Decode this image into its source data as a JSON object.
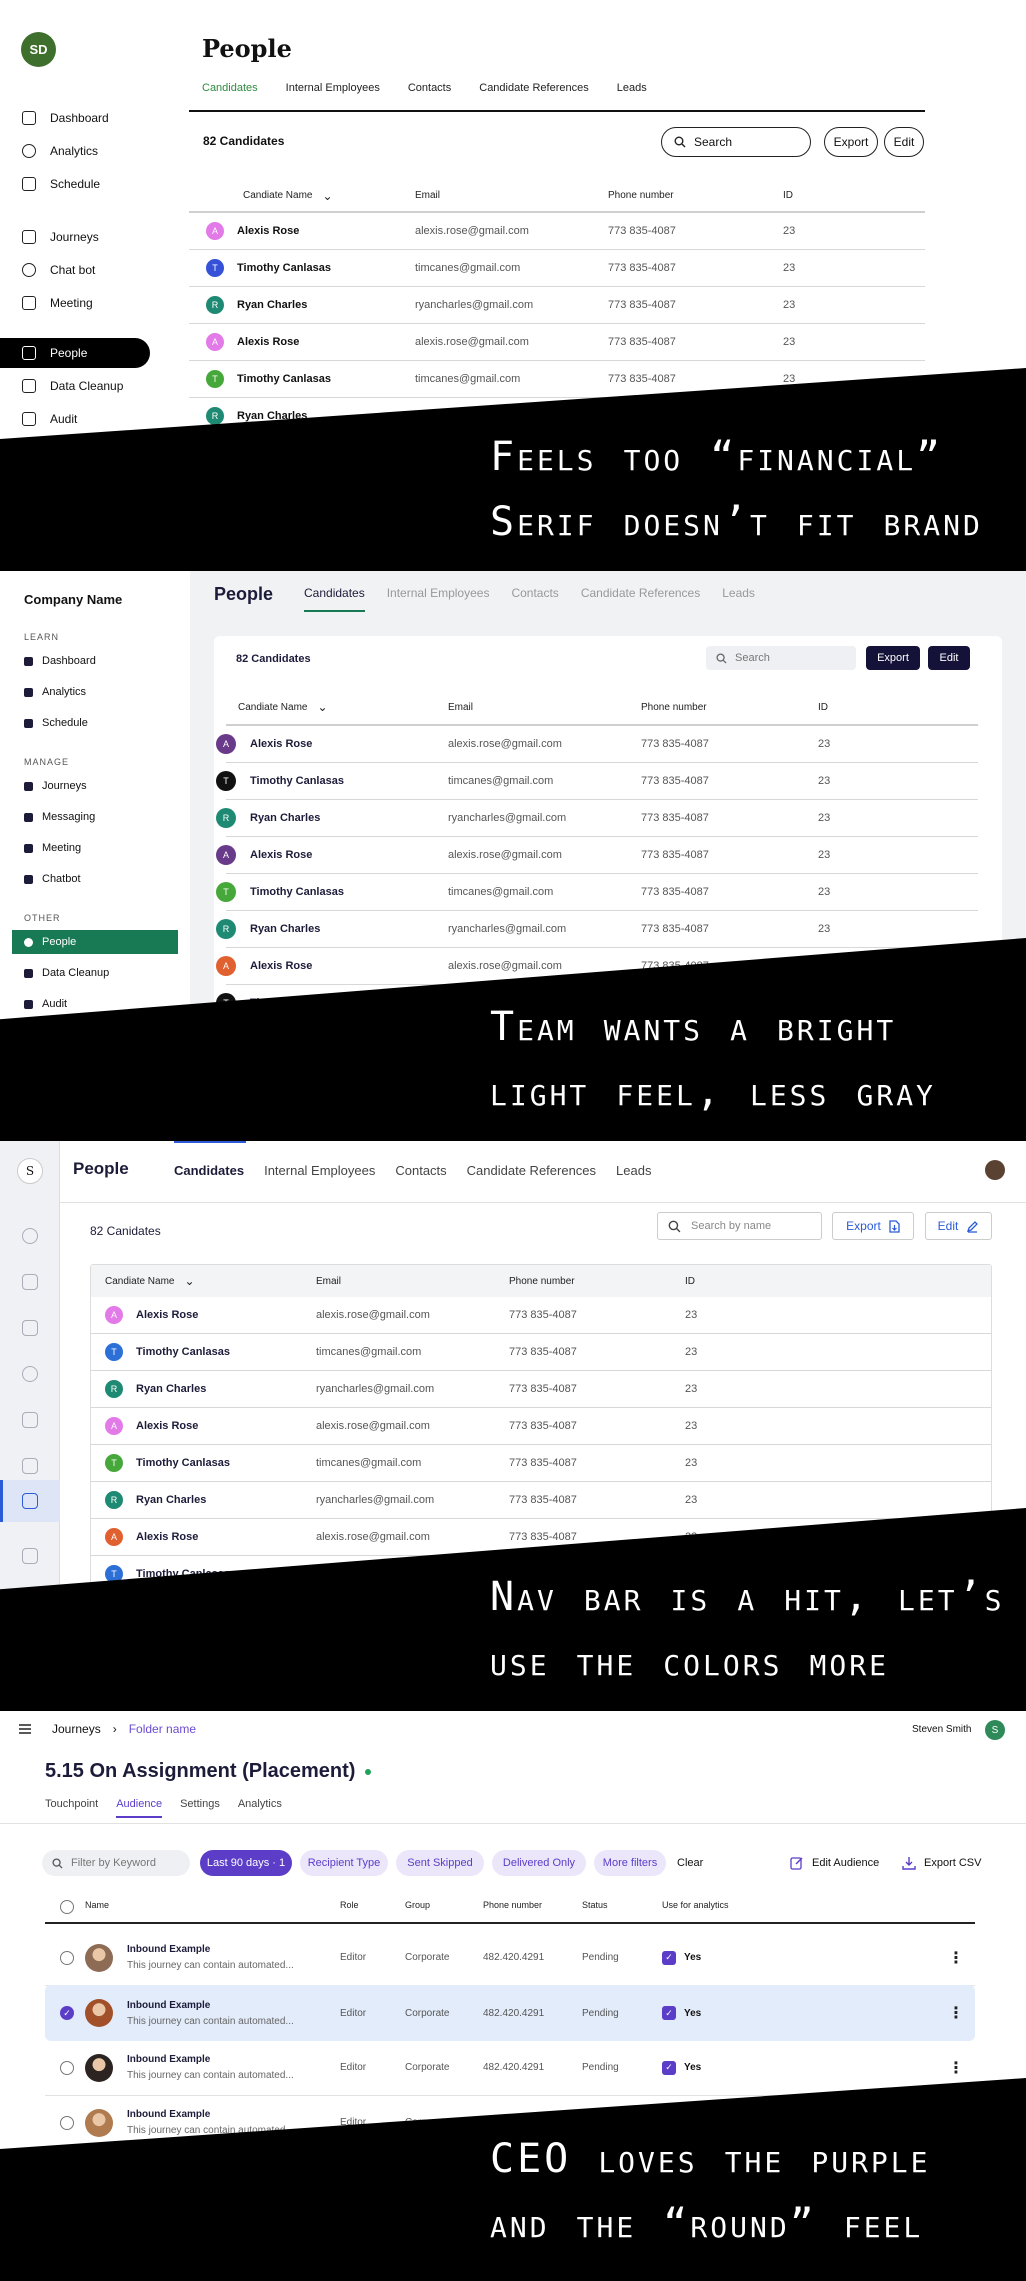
{
  "colors": {
    "v1_accent": "#2e8a3e",
    "v2_accent": "#177a55",
    "v2_button": "#141238",
    "v3_accent": "#2b5bd7",
    "v4_accent": "#5b3dc8"
  },
  "v1": {
    "avatar": "SD",
    "nav": [
      {
        "label": "Dashboard",
        "icon": "home-icon"
      },
      {
        "label": "Analytics",
        "icon": "analytics-icon"
      },
      {
        "label": "Schedule",
        "icon": "calendar-icon"
      },
      {
        "label": "Journeys",
        "icon": "link-icon"
      },
      {
        "label": "Chat bot",
        "icon": "chat-icon"
      },
      {
        "label": "Meeting",
        "icon": "meeting-icon"
      },
      {
        "label": "People",
        "icon": "people-icon"
      },
      {
        "label": "Data Cleanup",
        "icon": "table-icon"
      },
      {
        "label": "Audit",
        "icon": "clipboard-icon"
      }
    ],
    "title": "People",
    "tabs": [
      "Candidates",
      "Internal Employees",
      "Contacts",
      "Candidate References",
      "Leads"
    ],
    "count": "82 Candidates",
    "search": "Search",
    "export": "Export",
    "edit": "Edit",
    "columns": [
      "Candiate Name",
      "Email",
      "Phone number",
      "ID"
    ],
    "rows": [
      {
        "i": "A",
        "name": "Alexis Rose",
        "email": "alexis.rose@gmail.com",
        "phone": "773 835-4087",
        "id": "23",
        "color": "#e27ae8"
      },
      {
        "i": "T",
        "name": "Timothy Canlasas",
        "email": "timcanes@gmail.com",
        "phone": "773 835-4087",
        "id": "23",
        "color": "#3451d8"
      },
      {
        "i": "R",
        "name": "Ryan Charles",
        "email": "ryancharles@gmail.com",
        "phone": "773 835-4087",
        "id": "23",
        "color": "#1f8a73"
      },
      {
        "i": "A",
        "name": "Alexis Rose",
        "email": "alexis.rose@gmail.com",
        "phone": "773 835-4087",
        "id": "23",
        "color": "#e27ae8"
      },
      {
        "i": "T",
        "name": "Timothy Canlasas",
        "email": "timcanes@gmail.com",
        "phone": "773 835-4087",
        "id": "23",
        "color": "#46a83a"
      },
      {
        "i": "R",
        "name": "Ryan Charles",
        "email": "",
        "phone": "",
        "id": "",
        "color": "#1f8a73"
      }
    ],
    "note": [
      "Feels too “financial”",
      "Serif doesn’t fit brand"
    ]
  },
  "v2": {
    "company": "Company Name",
    "sections": [
      {
        "label": "LEARN",
        "items": [
          "Dashboard",
          "Analytics",
          "Schedule"
        ]
      },
      {
        "label": "MANAGE",
        "items": [
          "Journeys",
          "Messaging",
          "Meeting",
          "Chatbot"
        ]
      },
      {
        "label": "OTHER",
        "items": [
          "People",
          "Data Cleanup",
          "Audit"
        ]
      }
    ],
    "title": "People",
    "tabs": [
      "Candidates",
      "Internal Employees",
      "Contacts",
      "Candidate References",
      "Leads"
    ],
    "count": "82 Candidates",
    "search": "Search",
    "export": "Export",
    "edit": "Edit",
    "columns": [
      "Candiate Name",
      "Email",
      "Phone number",
      "ID"
    ],
    "rows": [
      {
        "i": "A",
        "name": "Alexis Rose",
        "email": "alexis.rose@gmail.com",
        "phone": "773 835-4087",
        "id": "23",
        "color": "#6a3a8a"
      },
      {
        "i": "T",
        "name": "Timothy Canlasas",
        "email": "timcanes@gmail.com",
        "phone": "773 835-4087",
        "id": "23",
        "color": "#111111"
      },
      {
        "i": "R",
        "name": "Ryan Charles",
        "email": "ryancharles@gmail.com",
        "phone": "773 835-4087",
        "id": "23",
        "color": "#1f8a73"
      },
      {
        "i": "A",
        "name": "Alexis Rose",
        "email": "alexis.rose@gmail.com",
        "phone": "773 835-4087",
        "id": "23",
        "color": "#6a3a8a"
      },
      {
        "i": "T",
        "name": "Timothy Canlasas",
        "email": "timcanes@gmail.com",
        "phone": "773 835-4087",
        "id": "23",
        "color": "#46a83a"
      },
      {
        "i": "R",
        "name": "Ryan Charles",
        "email": "ryancharles@gmail.com",
        "phone": "773 835-4087",
        "id": "23",
        "color": "#1f8a73"
      },
      {
        "i": "A",
        "name": "Alexis Rose",
        "email": "alexis.rose@gmail.com",
        "phone": "773 835-4087",
        "id": "23",
        "color": "#e0602f"
      },
      {
        "i": "T",
        "name": "Timothy Canlasas",
        "email": "",
        "phone": "",
        "id": "",
        "color": "#111111"
      }
    ],
    "note": [
      "Team wants a bright",
      "light feel, less gray"
    ]
  },
  "v3": {
    "logo": "S",
    "rail_icons": [
      "analytics-icon",
      "calendar-icon",
      "link-icon",
      "chat-icon",
      "bot-icon",
      "meeting-icon",
      "people-icon",
      "table-icon",
      "settings-icon"
    ],
    "title": "People",
    "tabs": [
      "Candidates",
      "Internal Employees",
      "Contacts",
      "Candidate References",
      "Leads"
    ],
    "count": "82 Canidates",
    "search_placeholder": "Search by name",
    "export": "Export",
    "edit": "Edit",
    "columns": [
      "Candiate Name",
      "Email",
      "Phone number",
      "ID"
    ],
    "rows": [
      {
        "i": "A",
        "name": "Alexis Rose",
        "email": "alexis.rose@gmail.com",
        "phone": "773 835-4087",
        "id": "23",
        "color": "#e27ae8"
      },
      {
        "i": "T",
        "name": "Timothy Canlasas",
        "email": "timcanes@gmail.com",
        "phone": "773 835-4087",
        "id": "23",
        "color": "#2b6fd7"
      },
      {
        "i": "R",
        "name": "Ryan Charles",
        "email": "ryancharles@gmail.com",
        "phone": "773 835-4087",
        "id": "23",
        "color": "#1f8a73"
      },
      {
        "i": "A",
        "name": "Alexis Rose",
        "email": "alexis.rose@gmail.com",
        "phone": "773 835-4087",
        "id": "23",
        "color": "#e27ae8"
      },
      {
        "i": "T",
        "name": "Timothy Canlasas",
        "email": "timcanes@gmail.com",
        "phone": "773 835-4087",
        "id": "23",
        "color": "#46a83a"
      },
      {
        "i": "R",
        "name": "Ryan Charles",
        "email": "ryancharles@gmail.com",
        "phone": "773 835-4087",
        "id": "23",
        "color": "#1f8a73"
      },
      {
        "i": "A",
        "name": "Alexis Rose",
        "email": "alexis.rose@gmail.com",
        "phone": "773 835-4087",
        "id": "23",
        "color": "#e0602f"
      },
      {
        "i": "T",
        "name": "Timothy Canlasas",
        "email": "",
        "phone": "",
        "id": "",
        "color": "#2b6fd7"
      }
    ],
    "note": [
      "Nav bar is a hit, let’s",
      "use the colors more"
    ]
  },
  "v4": {
    "crumb": "Journeys",
    "folder": "Folder name",
    "user": "Steven Smith",
    "user_initial": "S",
    "title": "5.15 On Assignment (Placement)",
    "tabs": [
      "Touchpoint",
      "Audience",
      "Settings",
      "Analytics"
    ],
    "filter_placeholder": "Filter by Keyword",
    "chips": [
      "Last 90 days · 1",
      "Recipient Type",
      "Sent Skipped",
      "Delivered Only",
      "More filters"
    ],
    "clear": "Clear",
    "edit_audience": "Edit Audience",
    "export_csv": "Export CSV",
    "columns": [
      "Name",
      "Role",
      "Group",
      "Phone number",
      "Status",
      "Use for analytics"
    ],
    "rows": [
      {
        "name": "Inbound Example",
        "desc": "This journey can contain automated...",
        "role": "Editor",
        "group": "Corporate",
        "phone": "482.420.4291",
        "status": "Pending",
        "analytics": "Yes",
        "selected": false,
        "photo": "#8d6b55"
      },
      {
        "name": "Inbound Example",
        "desc": "This journey can contain automated...",
        "role": "Editor",
        "group": "Corporate",
        "phone": "482.420.4291",
        "status": "Pending",
        "analytics": "Yes",
        "selected": true,
        "photo": "#a2502a"
      },
      {
        "name": "Inbound Example",
        "desc": "This journey can contain automated...",
        "role": "Editor",
        "group": "Corporate",
        "phone": "482.420.4291",
        "status": "Pending",
        "analytics": "Yes",
        "selected": false,
        "photo": "#2c2421"
      },
      {
        "name": "Inbound Example",
        "desc": "This journey can contain automated...",
        "role": "Editor",
        "group": "Corporate",
        "phone": "482.420.4291",
        "status": "",
        "analytics": "",
        "selected": false,
        "photo": "#b07b4f"
      }
    ],
    "note": [
      "CEO loves the purple",
      "and the “round” feel"
    ]
  }
}
